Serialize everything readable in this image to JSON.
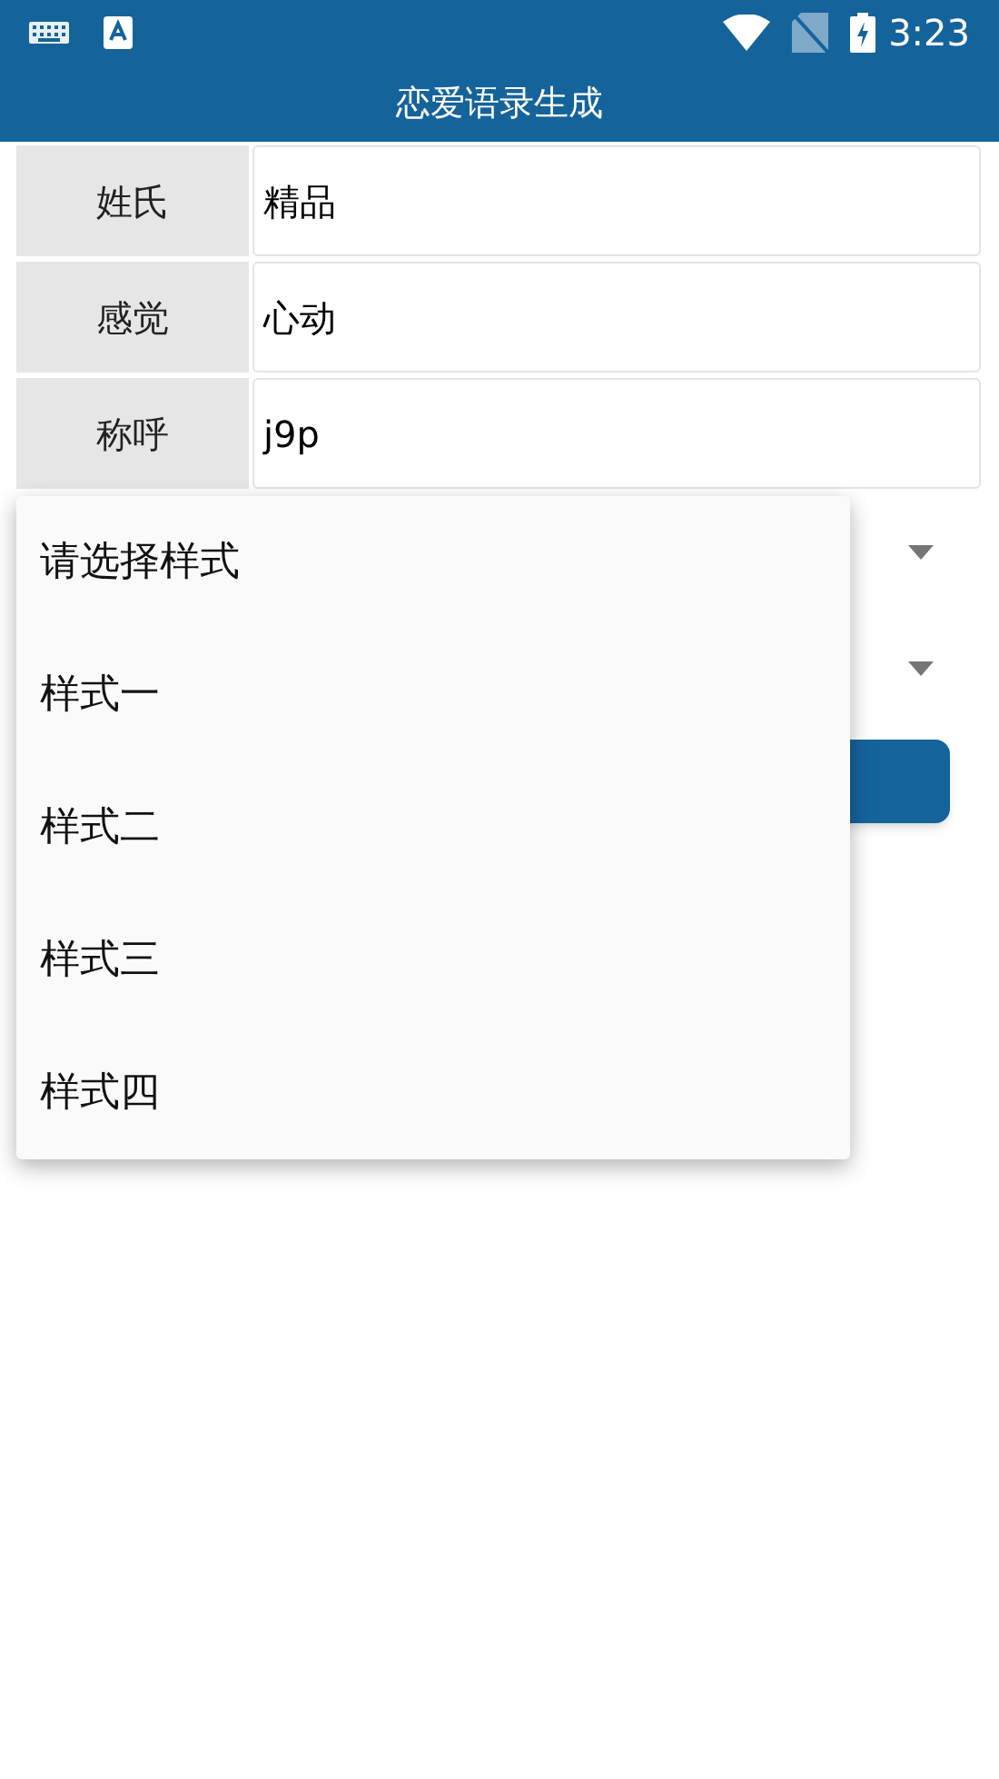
{
  "status_bar": {
    "time": "3:23"
  },
  "app_bar": {
    "title": "恋爱语录生成"
  },
  "fields": [
    {
      "label": "姓氏",
      "value": "精品"
    },
    {
      "label": "感觉",
      "value": "心动"
    },
    {
      "label": "称呼",
      "value": "j9p"
    }
  ],
  "dropdown_menu": {
    "items": [
      "请选择样式",
      "样式一",
      "样式二",
      "样式三",
      "样式四"
    ]
  }
}
